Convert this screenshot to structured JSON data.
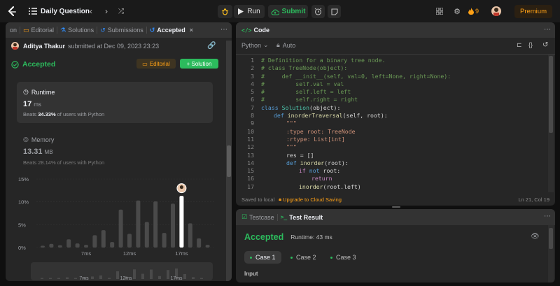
{
  "topbar": {
    "problem_list_label": "Daily Question",
    "run_label": "Run",
    "submit_label": "Submit",
    "streak": "9",
    "premium_label": "Premium"
  },
  "left_tabs": [
    {
      "label": "on"
    },
    {
      "label": "Editorial"
    },
    {
      "label": "Solutions"
    },
    {
      "label": "Submissions"
    },
    {
      "label": "Accepted"
    }
  ],
  "submission": {
    "user": "Aditya Thakur",
    "submitted_text": "submitted at Dec 09, 2023 23:23",
    "status": "Accepted",
    "editorial_btn": "Editorial",
    "solution_btn": "+ Solution"
  },
  "runtime": {
    "title": "Runtime",
    "value": "17",
    "unit": "ms",
    "beats_prefix": "Beats",
    "beats_value": "34.33%",
    "beats_suffix": "of users with Python"
  },
  "memory": {
    "title": "Memory",
    "value": "13.31",
    "unit": "MB",
    "beats_prefix": "Beats",
    "beats_value": "28.14%",
    "beats_suffix": "of users with Python"
  },
  "chart_data": {
    "type": "bar",
    "y_ticks": [
      "15%",
      "10%",
      "5%",
      "0%"
    ],
    "ylim": [
      0,
      15
    ],
    "x_ticks": [
      "7ms",
      "12ms",
      "17ms"
    ],
    "values": [
      0.4,
      0.8,
      0.5,
      1.8,
      0.9,
      0.6,
      2.7,
      3.8,
      1.2,
      8.3,
      3.0,
      10.3,
      5.6,
      10.1,
      3.2,
      9.6,
      11.3,
      5.3,
      2.0,
      0.6
    ],
    "highlight_index": 16,
    "mini_x_ticks": [
      "7ms",
      "12ms",
      "17ms"
    ]
  },
  "code_panel": {
    "title": "Code",
    "language": "Python",
    "mode": "Auto",
    "saved_text": "Saved to local",
    "upgrade_text": "Upgrade to Cloud Saving",
    "cursor_pos": "Ln 21, Col 19",
    "lines": [
      {
        "n": "1",
        "html_key": "l1"
      },
      {
        "n": "2",
        "html_key": "l2"
      },
      {
        "n": "3",
        "html_key": "l3"
      },
      {
        "n": "4",
        "html_key": "l4"
      },
      {
        "n": "5",
        "html_key": "l5"
      },
      {
        "n": "6",
        "html_key": "l6"
      },
      {
        "n": "7",
        "html_key": "l7"
      },
      {
        "n": "8",
        "html_key": "l8"
      },
      {
        "n": "9",
        "html_key": "l9"
      },
      {
        "n": "10",
        "html_key": "l10"
      },
      {
        "n": "11",
        "html_key": "l11"
      },
      {
        "n": "12",
        "html_key": "l12"
      },
      {
        "n": "13",
        "html_key": "l13"
      },
      {
        "n": "14",
        "html_key": "l14"
      },
      {
        "n": "15",
        "html_key": "l15"
      },
      {
        "n": "16",
        "html_key": "l16"
      },
      {
        "n": "17",
        "html_key": "l17"
      }
    ],
    "code": {
      "l1": "# Definition for a binary tree node.",
      "l2": "# class TreeNode(object):",
      "l3": "#     def __init__(self, val=0, left=None, right=None):",
      "l4": "#         self.val = val",
      "l5": "#         self.left = left",
      "l6": "#         self.right = right",
      "l7a": "class",
      "l7b": "Solution",
      "l7c": "(object):",
      "l8a": "def",
      "l8b": "inorderTraversal",
      "l8c": "(self, root):",
      "l9": "\"\"\"",
      "l10a": ":type root: ",
      "l10b": "TreeNode",
      "l11": ":rtype: List[int]",
      "l12": "\"\"\"",
      "l13": "res = []",
      "l14a": "def",
      "l14b": "inorder",
      "l14c": "(root):",
      "l15a": "if",
      "l15b": "not",
      "l15c": "root:",
      "l16": "return",
      "l17a": "inorder",
      "l17b": "(root.left)"
    }
  },
  "test_panel": {
    "testcase_tab": "Testcase",
    "result_tab": "Test Result",
    "status": "Accepted",
    "runtime_text": "Runtime: 43 ms",
    "cases": [
      "Case 1",
      "Case 2",
      "Case 3"
    ],
    "input_label": "Input"
  },
  "colors": {
    "accent_green": "#2cbb5d",
    "accent_orange": "#ffa116",
    "bar": "#4a4a4a",
    "bar_highlight": "#ffffff"
  }
}
